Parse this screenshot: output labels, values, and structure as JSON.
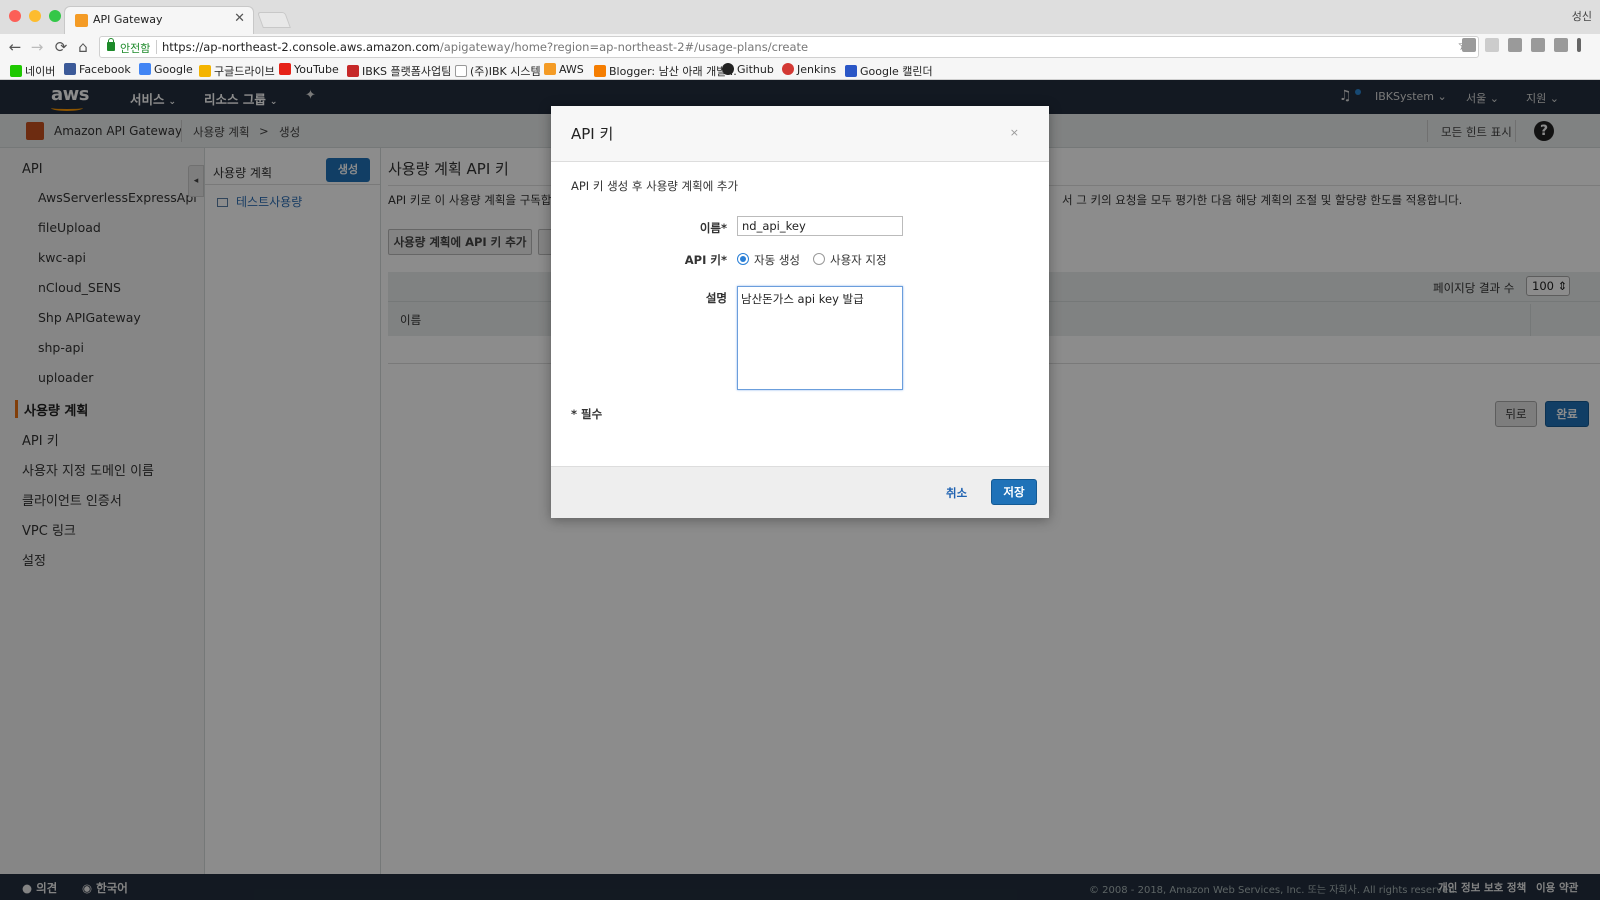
{
  "browser": {
    "tab_title": "API Gateway",
    "tab_close": "✕",
    "window_user": "성신",
    "secure_label": "안전함",
    "url_main": "https://ap-northeast-2.console.aws.amazon.com",
    "url_rest": "/apigateway/home?region=ap-northeast-2#/usage-plans/create",
    "nav": {
      "back": "←",
      "forward": "→",
      "reload": "⟳",
      "home": "⌂",
      "star": "☆"
    },
    "bookmarks": [
      {
        "label": "네이버",
        "color": "#1ec800"
      },
      {
        "label": "Facebook",
        "color": "#3b5998"
      },
      {
        "label": "Google",
        "color": "#4285f4"
      },
      {
        "label": "구글드라이브",
        "color": "#f4b400"
      },
      {
        "label": "YouTube",
        "color": "#e62117"
      },
      {
        "label": "IBKS 플랫폼사업팀",
        "color": "#c62828"
      },
      {
        "label": "(주)IBK 시스템",
        "color": "#999999"
      },
      {
        "label": "AWS",
        "color": "#f49b25"
      },
      {
        "label": "Blogger: 남산 아래 개발...",
        "color": "#f57d00"
      },
      {
        "label": "Github",
        "color": "#222222"
      },
      {
        "label": "Jenkins",
        "color": "#d33833"
      },
      {
        "label": "Google 캘린더",
        "color": "#2a56c6"
      }
    ]
  },
  "aws": {
    "logo": "aws",
    "nav": {
      "services": "서비스",
      "resource_groups": "리소스 그룹",
      "caret": "⌄"
    },
    "right": {
      "account": "IBKSystem",
      "region": "서울",
      "support": "지원"
    },
    "service_name": "Amazon API Gateway",
    "breadcrumbs": [
      "사용량 계획",
      ">",
      "생성"
    ],
    "hints": "모든 힌트 표시",
    "help": "?"
  },
  "leftnav": {
    "api_header": "API",
    "apis": [
      "AwsServerlessExpressApi",
      "fileUpload",
      "kwc-api",
      "nCloud_SENS",
      "Shp APIGateway",
      "shp-api",
      "uploader"
    ],
    "items": [
      "사용량 계획",
      "API 키",
      "사용자 지정 도메인 이름",
      "클라이언트 인증서",
      "VPC 링크",
      "설정"
    ],
    "collapse": "◂"
  },
  "midpanel": {
    "title": "사용량 계획",
    "create_btn": "생성",
    "item": "테스트사용량"
  },
  "main": {
    "title": "사용량 계획 API 키",
    "desc_left": "API 키로 이 사용량 계획을 구독합니",
    "desc_right": "서 그 키의 요청을 모두 평가한 다음 해당 계획의 조절 및 할당량 한도를 적용합니다.",
    "add_key_btn": "사용량 계획에 API 키 추가",
    "per_page_label": "페이지당 결과 수",
    "per_page_value": "100",
    "col_name": "이름",
    "back_btn": "뒤로",
    "done_btn": "완료"
  },
  "modal": {
    "title": "API 키",
    "close": "×",
    "subtitle": "API 키 생성 후 사용량 계획에 추가",
    "name_label": "이름*",
    "name_value": "nd_api_key",
    "apikey_label": "API 키*",
    "radio_auto": "자동 생성",
    "radio_custom": "사용자 지정",
    "desc_label": "설명",
    "desc_value": "남산돈가스 api key 발급",
    "required_note": "* 필수",
    "cancel": "취소",
    "save": "저장"
  },
  "footer": {
    "feedback": "의견",
    "language": "한국어",
    "copyright": "© 2008 - 2018, Amazon Web Services, Inc. 또는 자회사. All rights reserved.",
    "privacy": "개인 정보 보호 정책",
    "terms": "이용 약관"
  }
}
